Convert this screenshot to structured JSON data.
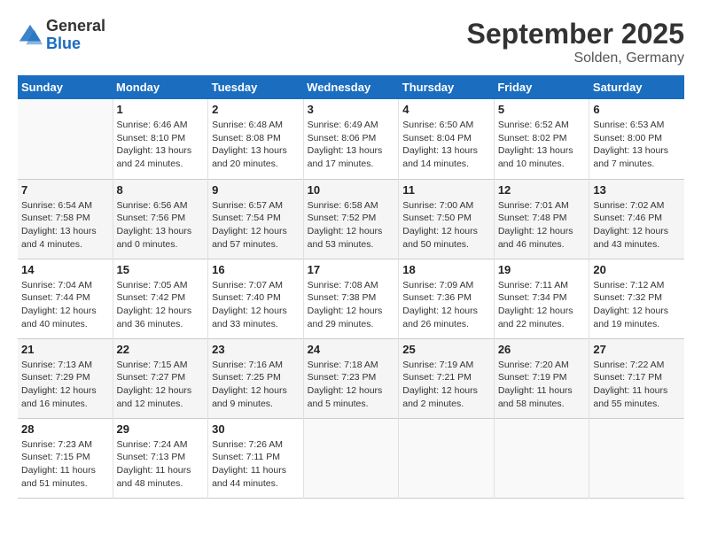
{
  "header": {
    "logo_general": "General",
    "logo_blue": "Blue",
    "month_title": "September 2025",
    "location": "Solden, Germany"
  },
  "days_of_week": [
    "Sunday",
    "Monday",
    "Tuesday",
    "Wednesday",
    "Thursday",
    "Friday",
    "Saturday"
  ],
  "weeks": [
    [
      {
        "day": "",
        "info": ""
      },
      {
        "day": "1",
        "info": "Sunrise: 6:46 AM\nSunset: 8:10 PM\nDaylight: 13 hours\nand 24 minutes."
      },
      {
        "day": "2",
        "info": "Sunrise: 6:48 AM\nSunset: 8:08 PM\nDaylight: 13 hours\nand 20 minutes."
      },
      {
        "day": "3",
        "info": "Sunrise: 6:49 AM\nSunset: 8:06 PM\nDaylight: 13 hours\nand 17 minutes."
      },
      {
        "day": "4",
        "info": "Sunrise: 6:50 AM\nSunset: 8:04 PM\nDaylight: 13 hours\nand 14 minutes."
      },
      {
        "day": "5",
        "info": "Sunrise: 6:52 AM\nSunset: 8:02 PM\nDaylight: 13 hours\nand 10 minutes."
      },
      {
        "day": "6",
        "info": "Sunrise: 6:53 AM\nSunset: 8:00 PM\nDaylight: 13 hours\nand 7 minutes."
      }
    ],
    [
      {
        "day": "7",
        "info": "Sunrise: 6:54 AM\nSunset: 7:58 PM\nDaylight: 13 hours\nand 4 minutes."
      },
      {
        "day": "8",
        "info": "Sunrise: 6:56 AM\nSunset: 7:56 PM\nDaylight: 13 hours\nand 0 minutes."
      },
      {
        "day": "9",
        "info": "Sunrise: 6:57 AM\nSunset: 7:54 PM\nDaylight: 12 hours\nand 57 minutes."
      },
      {
        "day": "10",
        "info": "Sunrise: 6:58 AM\nSunset: 7:52 PM\nDaylight: 12 hours\nand 53 minutes."
      },
      {
        "day": "11",
        "info": "Sunrise: 7:00 AM\nSunset: 7:50 PM\nDaylight: 12 hours\nand 50 minutes."
      },
      {
        "day": "12",
        "info": "Sunrise: 7:01 AM\nSunset: 7:48 PM\nDaylight: 12 hours\nand 46 minutes."
      },
      {
        "day": "13",
        "info": "Sunrise: 7:02 AM\nSunset: 7:46 PM\nDaylight: 12 hours\nand 43 minutes."
      }
    ],
    [
      {
        "day": "14",
        "info": "Sunrise: 7:04 AM\nSunset: 7:44 PM\nDaylight: 12 hours\nand 40 minutes."
      },
      {
        "day": "15",
        "info": "Sunrise: 7:05 AM\nSunset: 7:42 PM\nDaylight: 12 hours\nand 36 minutes."
      },
      {
        "day": "16",
        "info": "Sunrise: 7:07 AM\nSunset: 7:40 PM\nDaylight: 12 hours\nand 33 minutes."
      },
      {
        "day": "17",
        "info": "Sunrise: 7:08 AM\nSunset: 7:38 PM\nDaylight: 12 hours\nand 29 minutes."
      },
      {
        "day": "18",
        "info": "Sunrise: 7:09 AM\nSunset: 7:36 PM\nDaylight: 12 hours\nand 26 minutes."
      },
      {
        "day": "19",
        "info": "Sunrise: 7:11 AM\nSunset: 7:34 PM\nDaylight: 12 hours\nand 22 minutes."
      },
      {
        "day": "20",
        "info": "Sunrise: 7:12 AM\nSunset: 7:32 PM\nDaylight: 12 hours\nand 19 minutes."
      }
    ],
    [
      {
        "day": "21",
        "info": "Sunrise: 7:13 AM\nSunset: 7:29 PM\nDaylight: 12 hours\nand 16 minutes."
      },
      {
        "day": "22",
        "info": "Sunrise: 7:15 AM\nSunset: 7:27 PM\nDaylight: 12 hours\nand 12 minutes."
      },
      {
        "day": "23",
        "info": "Sunrise: 7:16 AM\nSunset: 7:25 PM\nDaylight: 12 hours\nand 9 minutes."
      },
      {
        "day": "24",
        "info": "Sunrise: 7:18 AM\nSunset: 7:23 PM\nDaylight: 12 hours\nand 5 minutes."
      },
      {
        "day": "25",
        "info": "Sunrise: 7:19 AM\nSunset: 7:21 PM\nDaylight: 12 hours\nand 2 minutes."
      },
      {
        "day": "26",
        "info": "Sunrise: 7:20 AM\nSunset: 7:19 PM\nDaylight: 11 hours\nand 58 minutes."
      },
      {
        "day": "27",
        "info": "Sunrise: 7:22 AM\nSunset: 7:17 PM\nDaylight: 11 hours\nand 55 minutes."
      }
    ],
    [
      {
        "day": "28",
        "info": "Sunrise: 7:23 AM\nSunset: 7:15 PM\nDaylight: 11 hours\nand 51 minutes."
      },
      {
        "day": "29",
        "info": "Sunrise: 7:24 AM\nSunset: 7:13 PM\nDaylight: 11 hours\nand 48 minutes."
      },
      {
        "day": "30",
        "info": "Sunrise: 7:26 AM\nSunset: 7:11 PM\nDaylight: 11 hours\nand 44 minutes."
      },
      {
        "day": "",
        "info": ""
      },
      {
        "day": "",
        "info": ""
      },
      {
        "day": "",
        "info": ""
      },
      {
        "day": "",
        "info": ""
      }
    ]
  ]
}
